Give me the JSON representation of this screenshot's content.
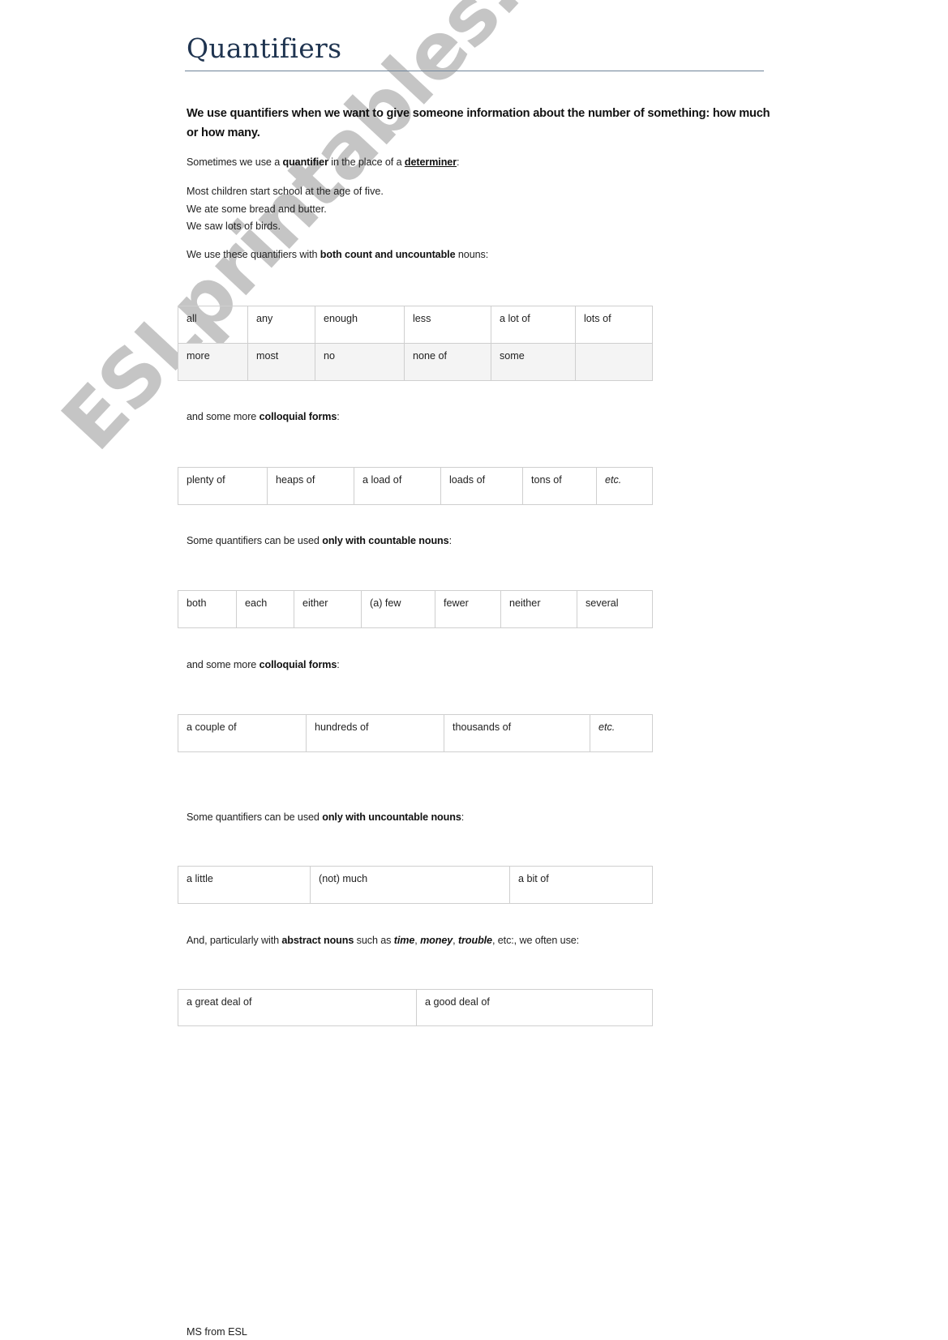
{
  "document": {
    "title": "Quantifiers",
    "intro": "We use quantifiers when we want to give someone information about the number of something: how much or how many.",
    "determiner_line": {
      "pre": "Sometimes we use a ",
      "bold": "quantifier",
      "mid": " in the place of a ",
      "underline_bold": "determiner",
      "post": ":"
    },
    "examples": [
      "Most children start school at the age of five.",
      "We ate some bread and butter.",
      "We saw lots of birds."
    ],
    "both_line": {
      "pre": "We use these quantifiers with ",
      "bold": "both count and uncountable",
      "post": " nouns:"
    },
    "table_both": [
      [
        "all",
        "any",
        "enough",
        "less",
        "a lot of",
        "lots of"
      ],
      [
        "more",
        "most",
        "no",
        "none of",
        "some",
        ""
      ]
    ],
    "colloquial_line_1": {
      "pre": "and some more ",
      "bold": "colloquial forms",
      "post": ":"
    },
    "table_colloquial_1": [
      [
        "plenty of",
        "heaps of",
        "a load of",
        "loads of",
        "tons of",
        "etc."
      ]
    ],
    "countable_line": {
      "pre": "Some quantifiers can be used ",
      "bold": "only with countable nouns",
      "post": ":"
    },
    "table_countable": [
      [
        "both",
        "each",
        "either",
        "(a) few",
        "fewer",
        "neither",
        "several"
      ]
    ],
    "colloquial_line_2": {
      "pre": "and some more ",
      "bold": "colloquial forms",
      "post": ":"
    },
    "table_colloquial_2": [
      [
        "a couple of",
        "hundreds of",
        "thousands of",
        "etc."
      ]
    ],
    "uncountable_line": {
      "pre": "Some quantifiers can be used ",
      "bold": "only with uncountable nouns",
      "post": ":"
    },
    "table_uncountable": [
      [
        "a little",
        "(not) much",
        "a bit of"
      ]
    ],
    "abstract_line": {
      "pre": "And, particularly with ",
      "bold": "abstract nouns",
      "mid": " such as ",
      "ex1": "time",
      "sep1": ", ",
      "ex2": "money",
      "sep2": ", ",
      "ex3": "trouble",
      "post": ", etc:,  we often use:"
    },
    "table_abstract": [
      [
        "a great deal of",
        "a good deal of"
      ]
    ],
    "footer": "MS from ESL"
  },
  "watermark": "ESLprintables.com",
  "colors": {
    "title": "#1f3450",
    "rule": "#6e8399",
    "table_border": "#cfcfcf",
    "shaded_row": "#f4f4f4"
  }
}
